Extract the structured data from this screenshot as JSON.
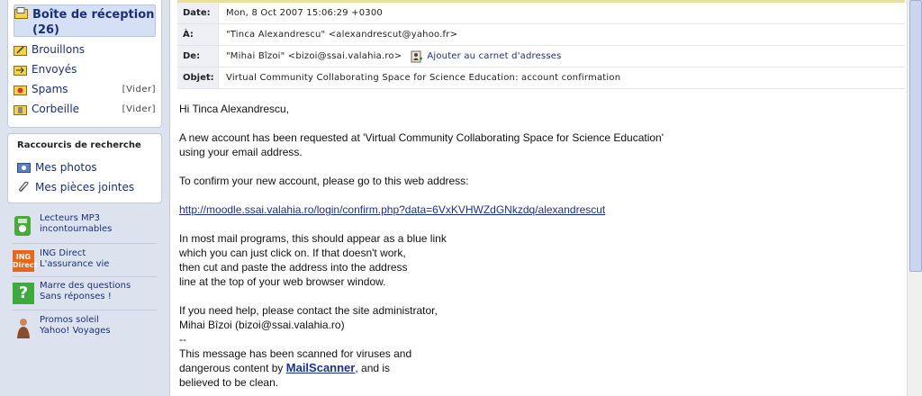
{
  "folders": [
    {
      "label": "Boîte de réception (26)",
      "empty": ""
    },
    {
      "label": "Brouillons",
      "empty": ""
    },
    {
      "label": "Envoyés",
      "empty": ""
    },
    {
      "label": "Spams",
      "empty": "[Vider]"
    },
    {
      "label": "Corbeille",
      "empty": "[Vider]"
    }
  ],
  "shortcuts": {
    "title": "Raccourcis de recherche",
    "items": [
      {
        "label": "Mes photos",
        "icon": "photo-icon"
      },
      {
        "label": "Mes pièces jointes",
        "icon": "paperclip-icon"
      }
    ]
  },
  "promos": [
    {
      "text": "Lecteurs MP3\nincontournables",
      "icon": "mp3-player-icon",
      "icon_color": "#4ca83a"
    },
    {
      "text": "ING Direct\nL'assurance vie",
      "icon": "ing-direct-icon",
      "icon_color": "#e8651a",
      "icon_text": "ING Direct"
    },
    {
      "text": "Marre des questions\nSans réponses !",
      "icon": "question-icon",
      "icon_color": "#3cab3c",
      "icon_text": "?"
    },
    {
      "text": "Promos soleil\nYahoo! Voyages",
      "icon": "traveler-icon",
      "icon_color": "#c98a5a"
    }
  ],
  "header": {
    "date_label": "Date:",
    "date_value": "Mon, 8 Oct 2007 15:06:29 +0300",
    "to_label": "À:",
    "to_value": "\"Tinca Alexandrescu\" <alexandrescut@yahoo.fr>",
    "from_label": "De:",
    "from_value": "\"Mihai Bîzoi\" <bizoi@ssai.valahia.ro>",
    "add_contact": "Ajouter au carnet d'adresses",
    "subject_label": "Objet:",
    "subject_value": "Virtual Community Collaborating Space for Science Education: account confirmation"
  },
  "body": {
    "greeting": "Hi Tinca Alexandrescu,",
    "p1_l1": "A new account has been requested at 'Virtual Community Collaborating Space for Science Education'",
    "p1_l2": "using your email address.",
    "p2": "To confirm your new account, please go to this web address:",
    "link": "http://moodle.ssai.valahia.ro/login/confirm.php?data=6VxKVHWZdGNkzdq/alexandrescut",
    "p3_l1": "In most mail programs, this should appear as a blue link",
    "p3_l2": "which you can just click on. If that doesn't work,",
    "p3_l3": "then cut and paste the address into the address",
    "p3_l4": "line at the top of your web browser window.",
    "p4_l1": "If you need help, please contact the site administrator,",
    "p4_l2": "Mihai Bîzoi (bizoi@ssai.valahia.ro)",
    "sig_sep": "--",
    "scan_l1": "This message has been scanned for viruses and",
    "scan_l2a": "dangerous content by ",
    "scan_link": "MailScanner",
    "scan_l2b": ", and is",
    "scan_l3": "believed to be clean."
  }
}
